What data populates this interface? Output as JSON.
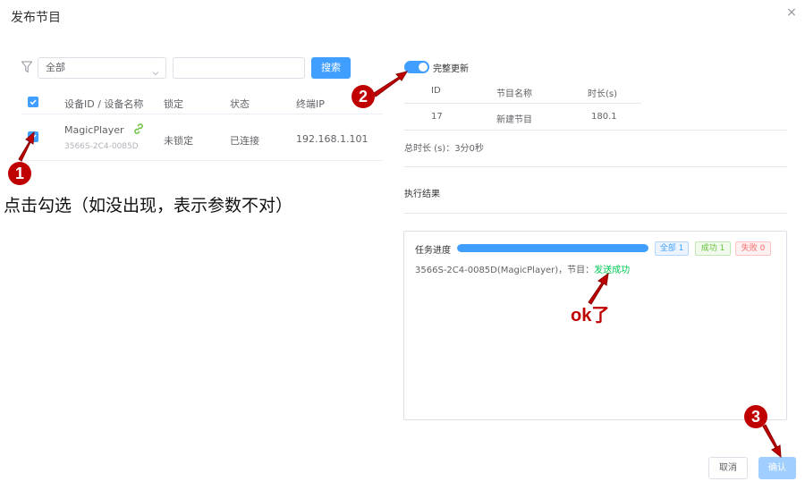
{
  "dialog": {
    "title": "发布节目",
    "close_icon": "close-icon"
  },
  "filter": {
    "icon": "filter-icon",
    "select_value": "全部",
    "search_value": "",
    "search_label": "搜索"
  },
  "device_table": {
    "headers": [
      "设备ID / 设备名称",
      "锁定",
      "状态",
      "终端IP"
    ],
    "rows": [
      {
        "checked": true,
        "name": "MagicPlayer",
        "id": "3566S-2C4-0085D",
        "lock": "未锁定",
        "status": "已连接",
        "ip": "192.168.1.101"
      }
    ]
  },
  "right_panel": {
    "toggle_label": "完整更新",
    "toggle_on": true,
    "headers": [
      "ID",
      "节目名称",
      "时长(s)"
    ],
    "rows": [
      {
        "id": "17",
        "name": "新建节目",
        "duration": "180.1"
      }
    ],
    "total": "总时长 (s)：3分0秒",
    "result_title": "执行结果"
  },
  "result": {
    "progress_label": "任务进度",
    "progress": 1.0,
    "badges": {
      "all": "全部 1",
      "success": "成功 1",
      "fail": "失败 0"
    },
    "log_prefix": "3566S-2C4-0085D(MagicPlayer)，节目：",
    "log_status": "发送成功"
  },
  "footer": {
    "cancel_label": "取消",
    "confirm_label": "确认"
  },
  "annotations": {
    "step1": "1",
    "step2": "2",
    "step3": "3",
    "note_check": "点击勾选（如没出现，表示参数不对）",
    "note_ok": "ok了"
  },
  "colors": {
    "primary": "#409eff",
    "annotation": "#c00000",
    "success": "#00c853"
  }
}
